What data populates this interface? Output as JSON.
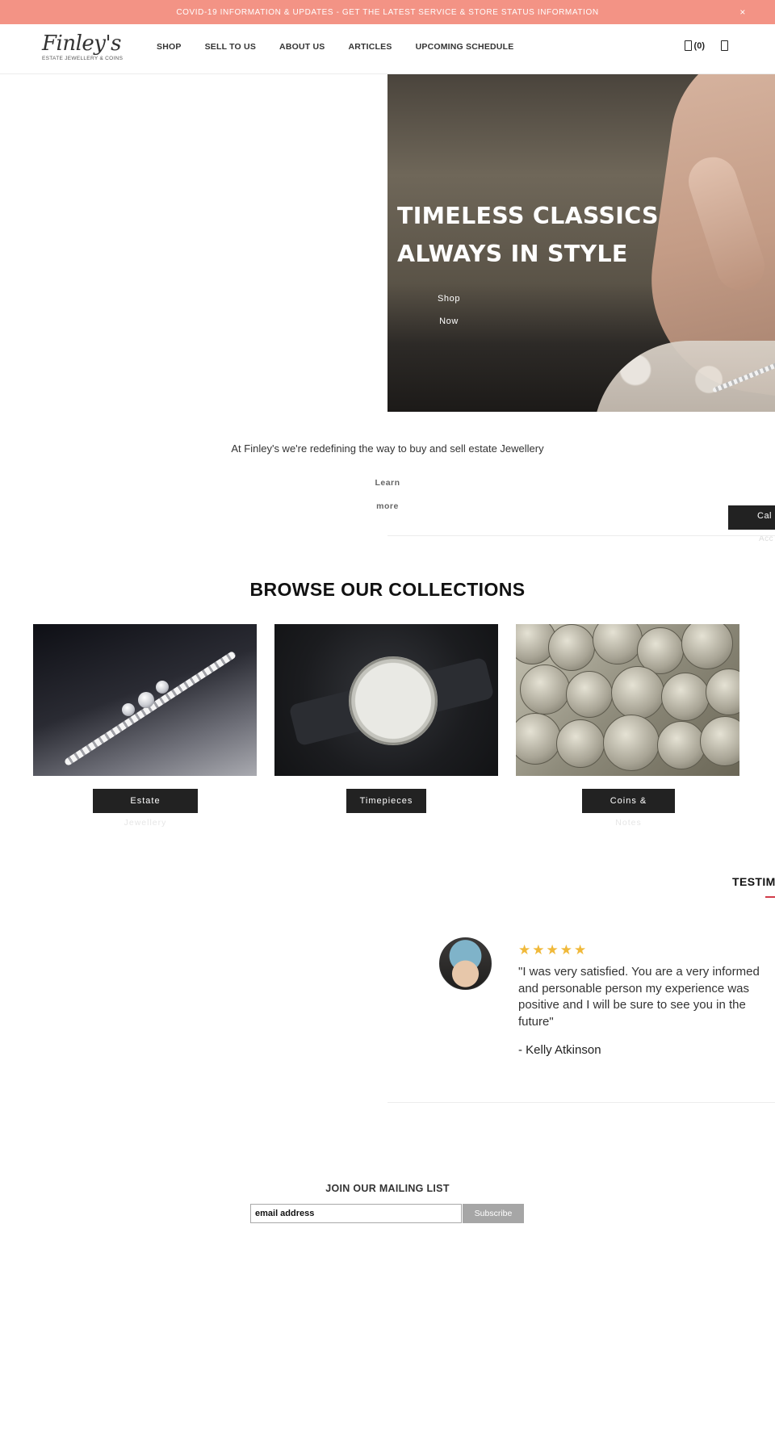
{
  "announcement": {
    "text": "COVID-19 INFORMATION & UPDATES - GET THE LATEST SERVICE & STORE STATUS INFORMATION",
    "close": "×"
  },
  "header": {
    "logo_script": "Finley's",
    "logo_sub": "ESTATE JEWELLERY & COINS",
    "nav": [
      "SHOP",
      "SELL TO US",
      "ABOUT US",
      "ARTICLES",
      "UPCOMING SCHEDULE"
    ],
    "cart_count": "(0)"
  },
  "hero": {
    "headline_line1": "TIMELESS CLASSICS",
    "headline_line2": "ALWAYS IN STYLE",
    "cta": "Shop Now"
  },
  "intro": {
    "text": "At Finley's we're redefining the way to buy and sell estate Jewellery",
    "learn_more": "Learn more",
    "call_label": "Cal",
    "call_sub": "Acc"
  },
  "collections": {
    "title": "BROWSE OUR COLLECTIONS",
    "items": [
      {
        "label": "Estate",
        "label_sub": "Jewellery"
      },
      {
        "label": "Timepieces",
        "label_sub": ""
      },
      {
        "label": "Coins &",
        "label_sub": "Notes"
      }
    ]
  },
  "testimonials": {
    "title": "TESTIMO",
    "stars": "★★★★★",
    "rating": 5,
    "quote": "\"I was very satisfied. You are a very informed and personable person my experience was positive and I will be sure to see you in the future\"",
    "author": "- Kelly Atkinson"
  },
  "mailing": {
    "title": "JOIN OUR MAILING LIST",
    "input_value": "email address",
    "button": "Subscribe"
  },
  "colors": {
    "announcement_bg": "#f39385",
    "dark_button": "#222222",
    "star": "#f0b93a",
    "accent_underline": "#d23c4a"
  },
  "icons": [
    "close-icon",
    "cart-icon",
    "account-icon"
  ]
}
